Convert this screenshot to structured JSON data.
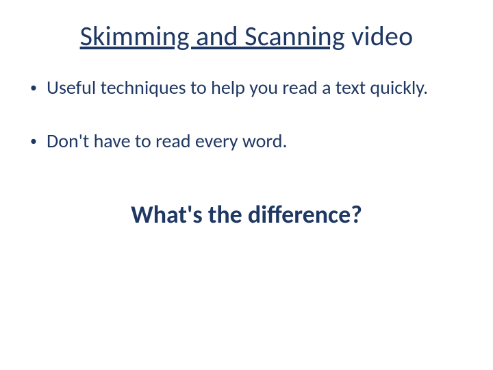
{
  "title": {
    "link_text": "Skimming and Scanning",
    "rest": " video"
  },
  "bullets": [
    "Useful techniques to help you read a text quickly.",
    "Don't have to read every word."
  ],
  "question": "What's the difference?"
}
